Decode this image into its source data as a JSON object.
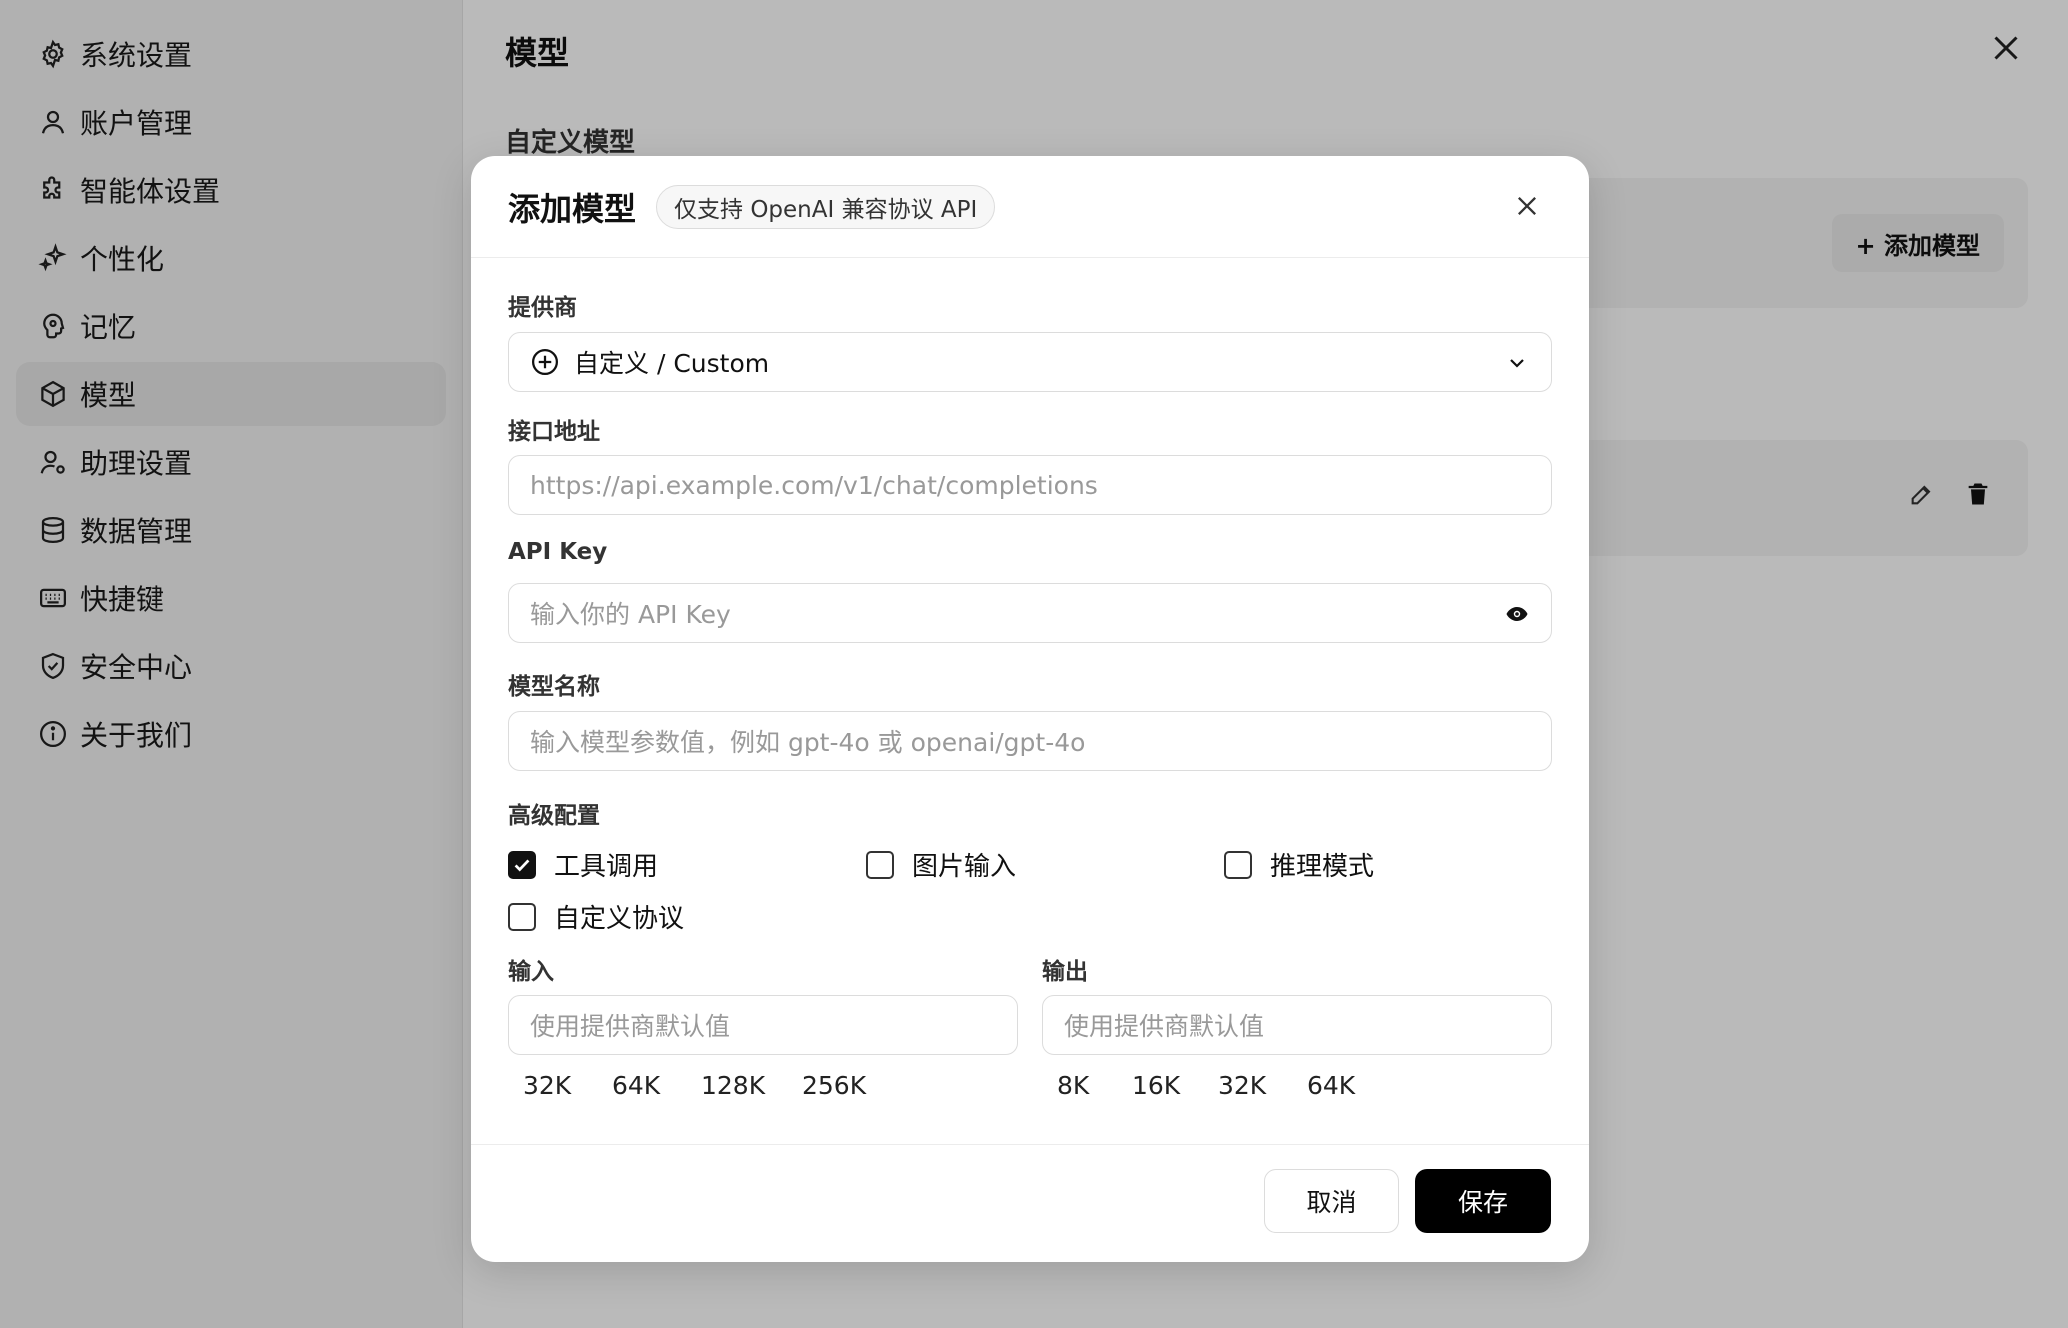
{
  "sidebar": {
    "items": [
      {
        "label": "系统设置",
        "icon": "gear-icon"
      },
      {
        "label": "账户管理",
        "icon": "user-icon"
      },
      {
        "label": "智能体设置",
        "icon": "puzzle-icon"
      },
      {
        "label": "个性化",
        "icon": "sparkle-icon"
      },
      {
        "label": "记忆",
        "icon": "brain-icon"
      },
      {
        "label": "模型",
        "icon": "cube-icon",
        "active": true
      },
      {
        "label": "助理设置",
        "icon": "user-gear-icon"
      },
      {
        "label": "数据管理",
        "icon": "database-icon"
      },
      {
        "label": "快捷键",
        "icon": "keyboard-icon"
      },
      {
        "label": "安全中心",
        "icon": "shield-icon"
      },
      {
        "label": "关于我们",
        "icon": "info-icon"
      }
    ]
  },
  "main": {
    "title": "模型",
    "section_title": "自定义模型",
    "add_model_label": "+ 添加模型"
  },
  "modal": {
    "title": "添加模型",
    "badge": "仅支持 OpenAI 兼容协议 API",
    "provider": {
      "label": "提供商",
      "value": "自定义 / Custom"
    },
    "endpoint": {
      "label": "接口地址",
      "placeholder": "https://api.example.com/v1/chat/completions"
    },
    "api_key": {
      "label": "API Key",
      "placeholder": "输入你的 API Key"
    },
    "model_name": {
      "label": "模型名称",
      "placeholder": "输入模型参数值，例如 gpt-4o 或 openai/gpt-4o"
    },
    "advanced": {
      "label": "高级配置",
      "options": [
        {
          "label": "工具调用",
          "checked": true
        },
        {
          "label": "图片输入",
          "checked": false
        },
        {
          "label": "推理模式",
          "checked": false
        },
        {
          "label": "自定义协议",
          "checked": false
        }
      ]
    },
    "input": {
      "label": "输入",
      "placeholder": "使用提供商默认值",
      "chips": [
        "32K",
        "64K",
        "128K",
        "256K"
      ]
    },
    "output": {
      "label": "输出",
      "placeholder": "使用提供商默认值",
      "chips": [
        "8K",
        "16K",
        "32K",
        "64K"
      ]
    },
    "cancel_label": "取消",
    "save_label": "保存"
  },
  "colors": {
    "primary": "#000000",
    "overlay": "rgba(0,0,0,0.27)"
  }
}
